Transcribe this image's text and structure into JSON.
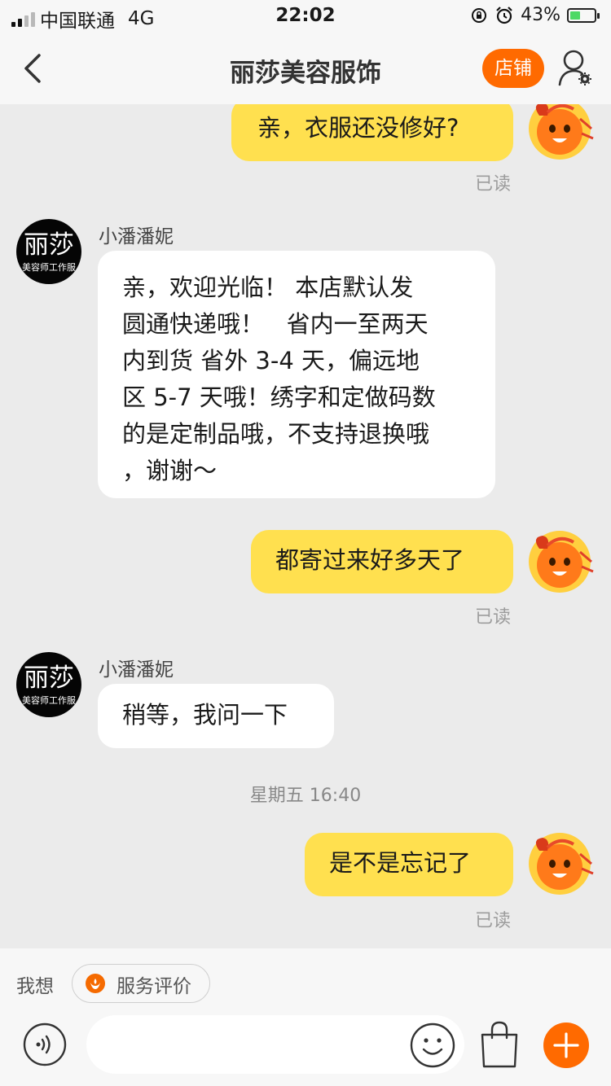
{
  "status_bar": {
    "carrier": "中国联通",
    "network": "4G",
    "time": "22:02",
    "battery": "43%",
    "battery_level": 0.43
  },
  "nav": {
    "title": "丽莎美容服饰",
    "shop_button": "店铺"
  },
  "messages": {
    "m1": {
      "text": "亲，衣服还没修好?",
      "status": "已读"
    },
    "m2": {
      "sender": "小潘潘妮",
      "avatar_big": "丽莎",
      "avatar_small": "美容师工作服",
      "lines": [
        "亲，欢迎光临！ 本店默认发",
        "圆通快递哦！   省内一至两天",
        "内到货 省外 3-4 天，偏远地",
        "区 5-7 天哦！绣字和定做码数",
        "的是定制品哦，不支持退换哦",
        "，谢谢～"
      ]
    },
    "m3": {
      "text": "都寄过来好多天了",
      "status": "已读"
    },
    "m4": {
      "sender": "小潘潘妮",
      "avatar_big": "丽莎",
      "avatar_small": "美容师工作服",
      "text": "稍等，我问一下"
    },
    "timestamp": "星期五 16:40",
    "m5": {
      "text": "是不是忘记了",
      "status": "已读"
    }
  },
  "quick_bar": {
    "label": "我想",
    "chip": "服务评价"
  },
  "input_bar": {
    "placeholder": ""
  },
  "colors": {
    "accent": "#ff6a00",
    "my_bubble": "#ffe04f",
    "their_bubble": "#ffffff",
    "background": "#ebebeb"
  },
  "icons": [
    "back-arrow-icon",
    "profile-settings-icon",
    "voice-icon",
    "emoji-icon",
    "shopping-bag-icon",
    "plus-icon",
    "service-rating-icon"
  ]
}
